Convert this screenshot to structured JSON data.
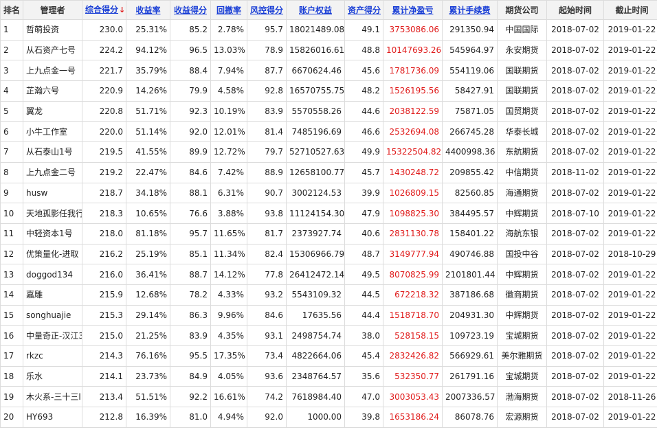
{
  "table": {
    "columns": [
      {
        "label": "排名",
        "sortable": false
      },
      {
        "label": "管理者",
        "sortable": false
      },
      {
        "label": "综合得分",
        "sortable": true,
        "sorted": true
      },
      {
        "label": "收益率",
        "sortable": true
      },
      {
        "label": "收益得分",
        "sortable": true
      },
      {
        "label": "回撤率",
        "sortable": true
      },
      {
        "label": "风控得分",
        "sortable": true
      },
      {
        "label": "账户权益",
        "sortable": true
      },
      {
        "label": "资产得分",
        "sortable": true
      },
      {
        "label": "累计净盈亏",
        "sortable": true
      },
      {
        "label": "累计手续费",
        "sortable": true
      },
      {
        "label": "期货公司",
        "sortable": false
      },
      {
        "label": "起始时间",
        "sortable": false
      },
      {
        "label": "截止时间",
        "sortable": false
      }
    ],
    "sort_indicator": "↓",
    "rows": [
      [
        "1",
        "哲萌投资",
        "230.0",
        "25.31%",
        "85.2",
        "2.78%",
        "95.7",
        "18021489.08",
        "49.1",
        "3753086.06",
        "291350.94",
        "中国国际",
        "2018-07-02",
        "2019-01-22"
      ],
      [
        "2",
        "从石资产七号",
        "224.2",
        "94.12%",
        "96.5",
        "13.03%",
        "78.9",
        "15826016.61",
        "48.8",
        "10147693.26",
        "545964.97",
        "永安期货",
        "2018-07-02",
        "2019-01-22"
      ],
      [
        "3",
        "上九点金一号",
        "221.7",
        "35.79%",
        "88.4",
        "7.94%",
        "87.7",
        "6670624.46",
        "45.6",
        "1781736.09",
        "554119.06",
        "国联期货",
        "2018-07-02",
        "2019-01-22"
      ],
      [
        "4",
        "芷瀚六号",
        "220.9",
        "14.26%",
        "79.9",
        "4.58%",
        "92.8",
        "16570755.75",
        "48.2",
        "1526195.56",
        "58427.91",
        "国联期货",
        "2018-07-02",
        "2019-01-22"
      ],
      [
        "5",
        "翼龙",
        "220.8",
        "51.71%",
        "92.3",
        "10.19%",
        "83.9",
        "5570558.26",
        "44.6",
        "2038122.59",
        "75871.05",
        "国贸期货",
        "2018-07-02",
        "2019-01-22"
      ],
      [
        "6",
        "小牛工作室",
        "220.0",
        "51.14%",
        "92.0",
        "12.01%",
        "81.4",
        "7485196.69",
        "46.6",
        "2532694.08",
        "266745.28",
        "华泰长城",
        "2018-07-02",
        "2019-01-22"
      ],
      [
        "7",
        "从石泰山1号",
        "219.5",
        "41.55%",
        "89.9",
        "12.72%",
        "79.7",
        "52710527.63",
        "49.9",
        "15322504.82",
        "4400998.36",
        "东航期货",
        "2018-07-02",
        "2019-01-22"
      ],
      [
        "8",
        "上九点金二号",
        "219.2",
        "22.47%",
        "84.6",
        "7.42%",
        "88.9",
        "12658100.77",
        "45.7",
        "1430248.72",
        "209855.42",
        "中信期货",
        "2018-11-02",
        "2019-01-22"
      ],
      [
        "9",
        "husw",
        "218.7",
        "34.18%",
        "88.1",
        "6.31%",
        "90.7",
        "3002124.53",
        "39.9",
        "1026809.15",
        "82560.85",
        "海通期货",
        "2018-07-02",
        "2019-01-22"
      ],
      [
        "10",
        "天地孤影任我行",
        "218.3",
        "10.65%",
        "76.6",
        "3.88%",
        "93.8",
        "11124154.30",
        "47.9",
        "1098825.30",
        "384495.57",
        "中辉期货",
        "2018-07-10",
        "2019-01-22"
      ],
      [
        "11",
        "中轻资本1号",
        "218.0",
        "81.18%",
        "95.7",
        "11.65%",
        "81.7",
        "2373927.74",
        "40.6",
        "2831130.78",
        "158401.22",
        "海航东银",
        "2018-07-02",
        "2019-01-22"
      ],
      [
        "12",
        "优策量化-进取",
        "216.2",
        "25.19%",
        "85.1",
        "11.34%",
        "82.4",
        "15306966.79",
        "48.7",
        "3149777.94",
        "490746.88",
        "国投中谷",
        "2018-07-02",
        "2018-10-29"
      ],
      [
        "13",
        "doggod134",
        "216.0",
        "36.41%",
        "88.7",
        "14.12%",
        "77.8",
        "26412472.14",
        "49.5",
        "8070825.99",
        "2101801.44",
        "中辉期货",
        "2018-07-02",
        "2019-01-22"
      ],
      [
        "14",
        "嘉雕",
        "215.9",
        "12.68%",
        "78.2",
        "4.33%",
        "93.2",
        "5543109.32",
        "44.5",
        "672218.32",
        "387186.68",
        "徽商期货",
        "2018-07-02",
        "2019-01-22"
      ],
      [
        "15",
        "songhuajie",
        "215.3",
        "29.14%",
        "86.3",
        "9.96%",
        "84.6",
        "17635.56",
        "44.4",
        "1518718.70",
        "204931.30",
        "中辉期货",
        "2018-07-02",
        "2019-01-22"
      ],
      [
        "16",
        "中量奇正-汉江3",
        "215.0",
        "21.25%",
        "83.9",
        "4.35%",
        "93.1",
        "2498754.74",
        "38.0",
        "528158.15",
        "109723.19",
        "宝城期货",
        "2018-07-02",
        "2019-01-22"
      ],
      [
        "17",
        "rkzc",
        "214.3",
        "76.16%",
        "95.5",
        "17.35%",
        "73.4",
        "4822664.06",
        "45.4",
        "2832426.82",
        "566929.61",
        "美尔雅期货",
        "2018-07-02",
        "2019-01-22"
      ],
      [
        "18",
        "乐水",
        "214.1",
        "23.73%",
        "84.9",
        "4.05%",
        "93.6",
        "2348764.57",
        "35.6",
        "532350.77",
        "261791.16",
        "宝城期货",
        "2018-07-02",
        "2019-01-22"
      ],
      [
        "19",
        "木火系-三十三l",
        "213.4",
        "51.51%",
        "92.2",
        "16.61%",
        "74.2",
        "7618984.40",
        "47.0",
        "3003053.43",
        "2007336.57",
        "渤海期货",
        "2018-07-02",
        "2018-11-26"
      ],
      [
        "20",
        "HY693",
        "212.8",
        "16.39%",
        "81.0",
        "4.94%",
        "92.0",
        "1000.00",
        "39.8",
        "1653186.24",
        "86078.76",
        "宏源期货",
        "2018-07-02",
        "2019-01-22"
      ]
    ]
  },
  "colors": {
    "link": "#1a3fd6",
    "profit": "#e01b1b",
    "header_bg": "#f3f3f3",
    "border": "#dcdcdc"
  }
}
